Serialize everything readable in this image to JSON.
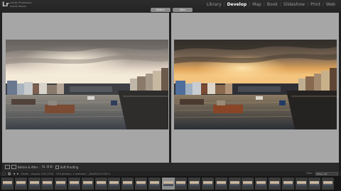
{
  "app": {
    "logo": "Lr",
    "identity_line1": "Adobe Photoshop",
    "identity_line2": "David Nelson"
  },
  "modules": [
    {
      "label": "Library",
      "active": false
    },
    {
      "label": "Develop",
      "active": true
    },
    {
      "label": "Map",
      "active": false
    },
    {
      "label": "Book",
      "active": false
    },
    {
      "label": "Slideshow",
      "active": false
    },
    {
      "label": "Print",
      "active": false
    },
    {
      "label": "Web",
      "active": false
    }
  ],
  "compare": {
    "before_label": "Before",
    "after_label": "After"
  },
  "toolbar": {
    "mode_label": "Before & After :",
    "swap_icons": "⇆ ⇉ ⇇",
    "soft_proofing_label": "Soft Proofing"
  },
  "filmbar": {
    "source_text": "Folder : August 17th 2016",
    "count_text": "230 photos / 1 selected / _DAVE0123.CR2 ▾",
    "filter_label": "Filter :",
    "filter_value": "Filters Off"
  },
  "filmstrip": {
    "count": 25,
    "selected_index": 12
  },
  "colors": {
    "pane_bg": "#a6a6a6",
    "chrome_bg": "#1b1b1b",
    "active_module": "#ffffff"
  }
}
